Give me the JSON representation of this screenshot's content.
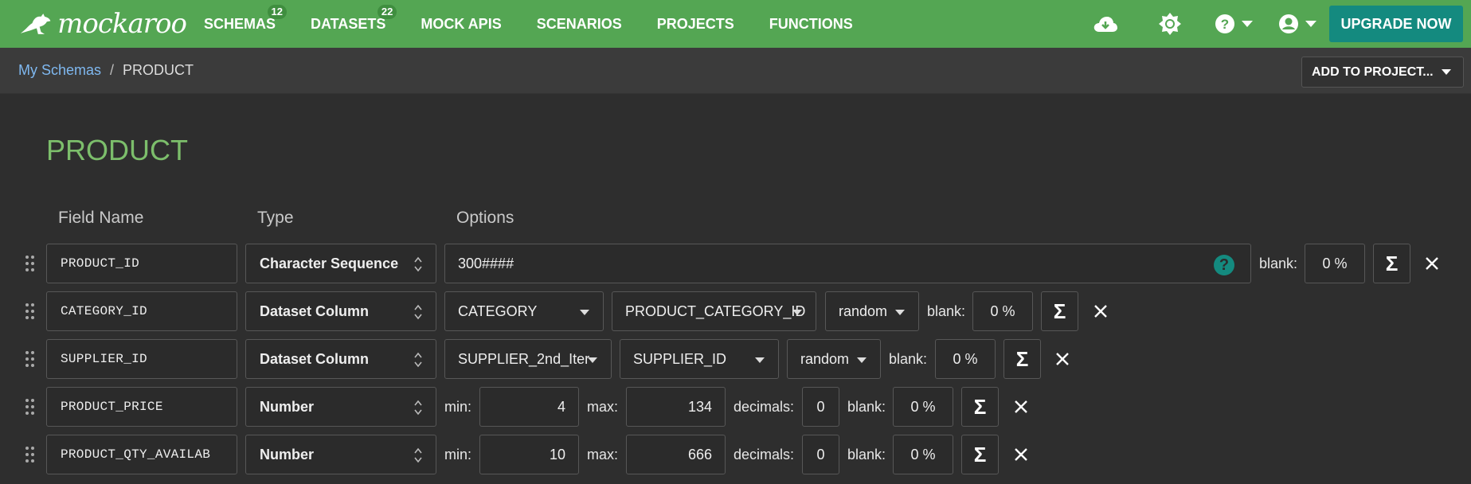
{
  "app": {
    "name": "mockaroo"
  },
  "nav": [
    {
      "label": "SCHEMAS",
      "badge": "12"
    },
    {
      "label": "DATASETS",
      "badge": "22"
    },
    {
      "label": "MOCK APIS"
    },
    {
      "label": "SCENARIOS"
    },
    {
      "label": "PROJECTS"
    },
    {
      "label": "FUNCTIONS"
    }
  ],
  "topright": {
    "upgrade_label": "UPGRADE NOW"
  },
  "breadcrumb": {
    "root": "My Schemas",
    "sep": "/",
    "current": "PRODUCT"
  },
  "add_project_label": "ADD TO PROJECT...",
  "schema": {
    "title": "PRODUCT"
  },
  "columns": {
    "field_name": "Field Name",
    "type": "Type",
    "options": "Options"
  },
  "labels": {
    "blank": "blank:",
    "min": "min:",
    "max": "max:",
    "decimals": "decimals:",
    "sigma": "Σ"
  },
  "fields": [
    {
      "name": "PRODUCT_ID",
      "type": "Character Sequence",
      "format": "300####",
      "blank": "0 %"
    },
    {
      "name": "CATEGORY_ID",
      "type": "Dataset Column",
      "dataset": "CATEGORY",
      "column": "PRODUCT_CATEGORY_ID",
      "mode": "random",
      "blank": "0 %"
    },
    {
      "name": "SUPPLIER_ID",
      "type": "Dataset Column",
      "dataset": "SUPPLIER_2nd_Iter",
      "column": "SUPPLIER_ID",
      "mode": "random",
      "blank": "0 %"
    },
    {
      "name": "PRODUCT_PRICE",
      "type": "Number",
      "min": "4",
      "max": "134",
      "decimals": "0",
      "blank": "0 %"
    },
    {
      "name": "PRODUCT_QTY_AVAILAB",
      "type": "Number",
      "min": "10",
      "max": "666",
      "decimals": "0",
      "blank": "0 %"
    }
  ],
  "colors": {
    "topbar": "#54a653",
    "accent": "#148a7f",
    "title": "#7cbe6b",
    "link": "#7fb8f0"
  },
  "icons": [
    "kangaroo-logo-icon",
    "cloud-download-icon",
    "brightness-icon",
    "help-icon",
    "account-icon",
    "sigma-icon",
    "close-icon",
    "drag-handle-icon"
  ]
}
